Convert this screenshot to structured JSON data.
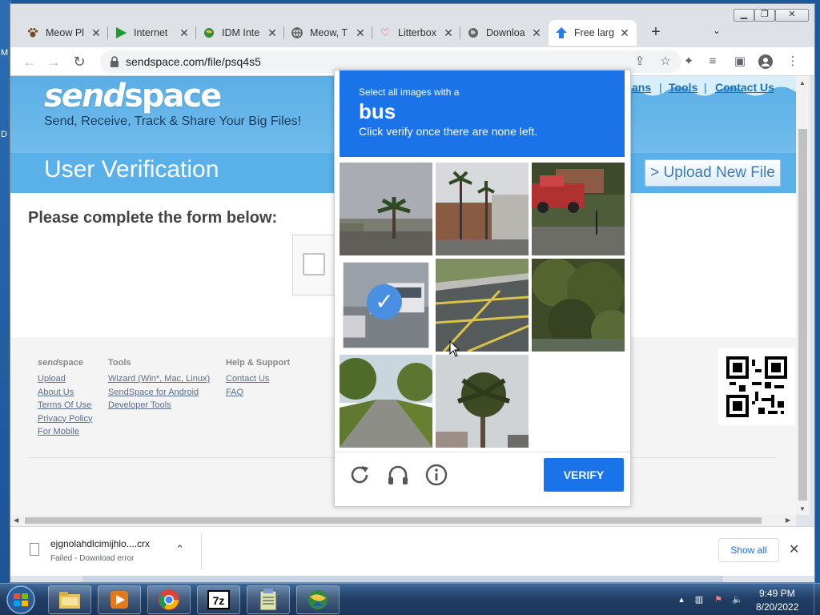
{
  "desktop": {
    "letters": [
      "M",
      "D"
    ]
  },
  "browser": {
    "tabs": [
      {
        "title": "Meow Pl",
        "icon": "paw-icon"
      },
      {
        "title": "Internet",
        "icon": "play-icon"
      },
      {
        "title": "IDM Inte",
        "icon": "globe-icon"
      },
      {
        "title": "Meow, T",
        "icon": "globe-icon"
      },
      {
        "title": "Litterbox",
        "icon": "heart-icon"
      },
      {
        "title": "Downloa",
        "icon": "globe-icon"
      },
      {
        "title": "Free larg",
        "icon": "upload-arrow-icon",
        "active": true
      }
    ],
    "url": "sendspace.com/file/psq4s5"
  },
  "site": {
    "logo_a": "send",
    "logo_b": "space",
    "tagline": "Send, Receive, Track & Share Your Big Files!",
    "page_title": "User Verification",
    "nav": [
      "ans",
      "Tools",
      "Contact Us"
    ],
    "upload_button": "> Upload New File",
    "form_heading": "Please complete the form below:",
    "footer": {
      "col1_head_italic": "send",
      "col1_head_rest": "space",
      "col1_links": [
        "Upload",
        "About Us",
        "Terms Of Use",
        "Privacy Policy",
        "For Mobile"
      ],
      "col2_head": "Tools",
      "col2_links": [
        "Wizard (Win*, Mac, Linux)",
        "SendSpace for Android",
        "Developer Tools"
      ],
      "col3_head": "Help & Support",
      "col3_links": [
        "Contact Us",
        "FAQ"
      ]
    }
  },
  "captcha": {
    "select_text": "Select all images with a",
    "object": "bus",
    "instruction": "Click verify once there are none left.",
    "verify_label": "VERIFY",
    "selected_tile": 3
  },
  "download": {
    "filename": "ejgnolahdlcimijhlo....crx",
    "status": "Failed - Download error",
    "show_all": "Show all"
  },
  "taskbar": {
    "time": "9:49 PM",
    "date": "8/20/2022"
  },
  "colors": {
    "captcha_blue": "#1a73e8",
    "header_blue": "#5ab0e8"
  }
}
